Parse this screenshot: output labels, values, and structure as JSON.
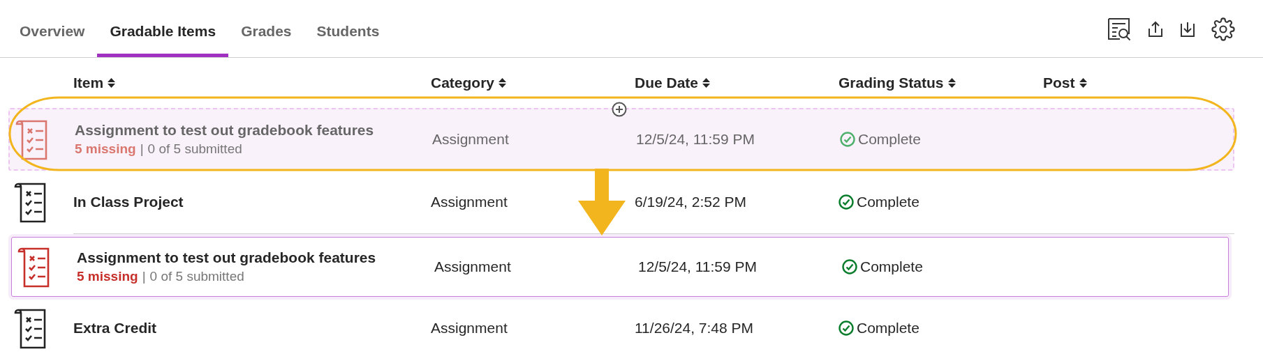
{
  "tabs": [
    {
      "label": "Overview",
      "selected": false
    },
    {
      "label": "Gradable Items",
      "selected": true
    },
    {
      "label": "Grades",
      "selected": false
    },
    {
      "label": "Students",
      "selected": false
    }
  ],
  "toolbar": [
    {
      "kind": "search-report"
    },
    {
      "kind": "upload"
    },
    {
      "kind": "download"
    },
    {
      "kind": "settings"
    }
  ],
  "columns": [
    "Item",
    "Category",
    "Due Date",
    "Grading Status",
    "Post"
  ],
  "rows": [
    {
      "kind": "dragging",
      "title": "Assignment to test out gradebook features",
      "missing": "5 missing",
      "separator": "|",
      "submitted": "0 of 5 submitted",
      "category": "Assignment",
      "due": "12/5/24, 11:59 PM",
      "status": "Complete"
    },
    {
      "kind": "normal",
      "title": "In Class Project",
      "category": "Assignment",
      "due": "6/19/24, 2:52 PM",
      "status": "Complete"
    },
    {
      "kind": "drop-target",
      "title": "Assignment to test out gradebook features",
      "missing": "5 missing",
      "separator": "|",
      "submitted": "0 of 5 submitted",
      "category": "Assignment",
      "due": "12/5/24, 11:59 PM",
      "status": "Complete"
    },
    {
      "kind": "normal",
      "title": "Extra Credit",
      "category": "Assignment",
      "due": "11/26/24, 7:48 PM",
      "status": "Complete"
    }
  ],
  "annotations": {
    "ellipse": true,
    "arrow": true
  }
}
